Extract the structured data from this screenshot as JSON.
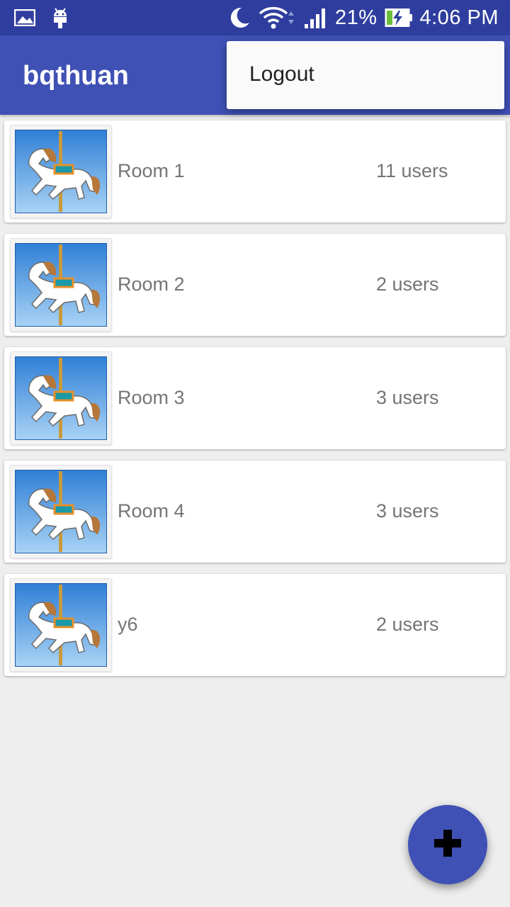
{
  "status_bar": {
    "left_icons": [
      "image-notification-icon",
      "android-debug-icon"
    ],
    "right_icons": [
      "do-not-disturb-moon-icon",
      "wifi-icon",
      "cellular-signal-icon",
      "battery-charging-icon"
    ],
    "battery_percent": "21%",
    "time": "4:06 PM",
    "background": "#2f3e9e"
  },
  "app_bar": {
    "title": "bqthuan",
    "background": "#3f51b5"
  },
  "overflow_menu": {
    "items": [
      {
        "label": "Logout"
      }
    ]
  },
  "rooms": [
    {
      "name": "Room 1",
      "users": "11 users",
      "thumbnail_icon": "carousel-horse-icon"
    },
    {
      "name": "Room 2",
      "users": "2 users",
      "thumbnail_icon": "carousel-horse-icon"
    },
    {
      "name": "Room 3",
      "users": "3 users",
      "thumbnail_icon": "carousel-horse-icon"
    },
    {
      "name": "Room 4",
      "users": "3 users",
      "thumbnail_icon": "carousel-horse-icon"
    },
    {
      "name": "y6",
      "users": "2 users",
      "thumbnail_icon": "carousel-horse-icon"
    }
  ],
  "fab": {
    "icon": "plus-icon",
    "background": "#3f51b5"
  }
}
